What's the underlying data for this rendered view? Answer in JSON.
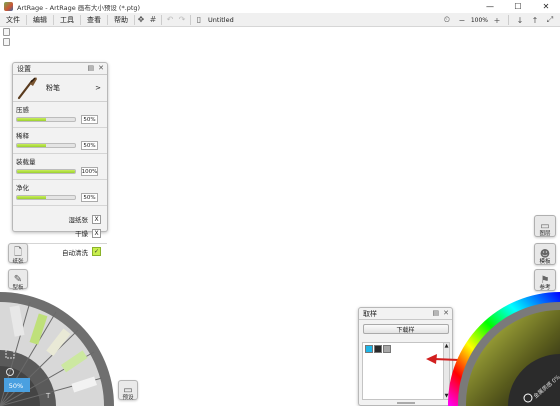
{
  "window": {
    "title": "ArtRage - ArtRage 画布大小预设 (*.ptg)",
    "controls": [
      "—",
      "☐",
      "✕"
    ]
  },
  "menu": {
    "items": [
      "文件",
      "编辑",
      "工具",
      "查看",
      "帮助"
    ],
    "doc_title": "Untitled",
    "zoom": "100%"
  },
  "settings_panel": {
    "title": "设置",
    "tool_name": "粉笔",
    "tool_arrow": ">",
    "sliders": [
      {
        "label": "压感",
        "value": "50%",
        "fill": 0.5
      },
      {
        "label": "稀释",
        "value": "50%",
        "fill": 0.5
      },
      {
        "label": "装载量",
        "value": "100%",
        "fill": 1.0
      },
      {
        "label": "净化",
        "value": "50%",
        "fill": 0.5
      }
    ],
    "toggles": [
      {
        "label": "湿纸张",
        "state": "X"
      },
      {
        "label": "干燥",
        "state": "X"
      },
      {
        "label": "自动清洗",
        "state": "✓"
      }
    ]
  },
  "left_buttons": {
    "paper": "纸张",
    "metallic": "型板"
  },
  "right_buttons": {
    "layers": "图层",
    "samples": "参考",
    "stencils": "模板"
  },
  "sampler_panel": {
    "title": "取样",
    "take_button": "下载样",
    "swatches": [
      "#1fb6e8",
      "#2a2a2a",
      "#a8a8a8"
    ]
  },
  "tool_picker": {
    "zoom_value": "50%"
  },
  "color_picker": {
    "metallic_label": "金属质感 0%"
  },
  "presets_button": "预设",
  "colors": {
    "accent_green": "#9bd12e",
    "arrow_red": "#d11f1f"
  }
}
